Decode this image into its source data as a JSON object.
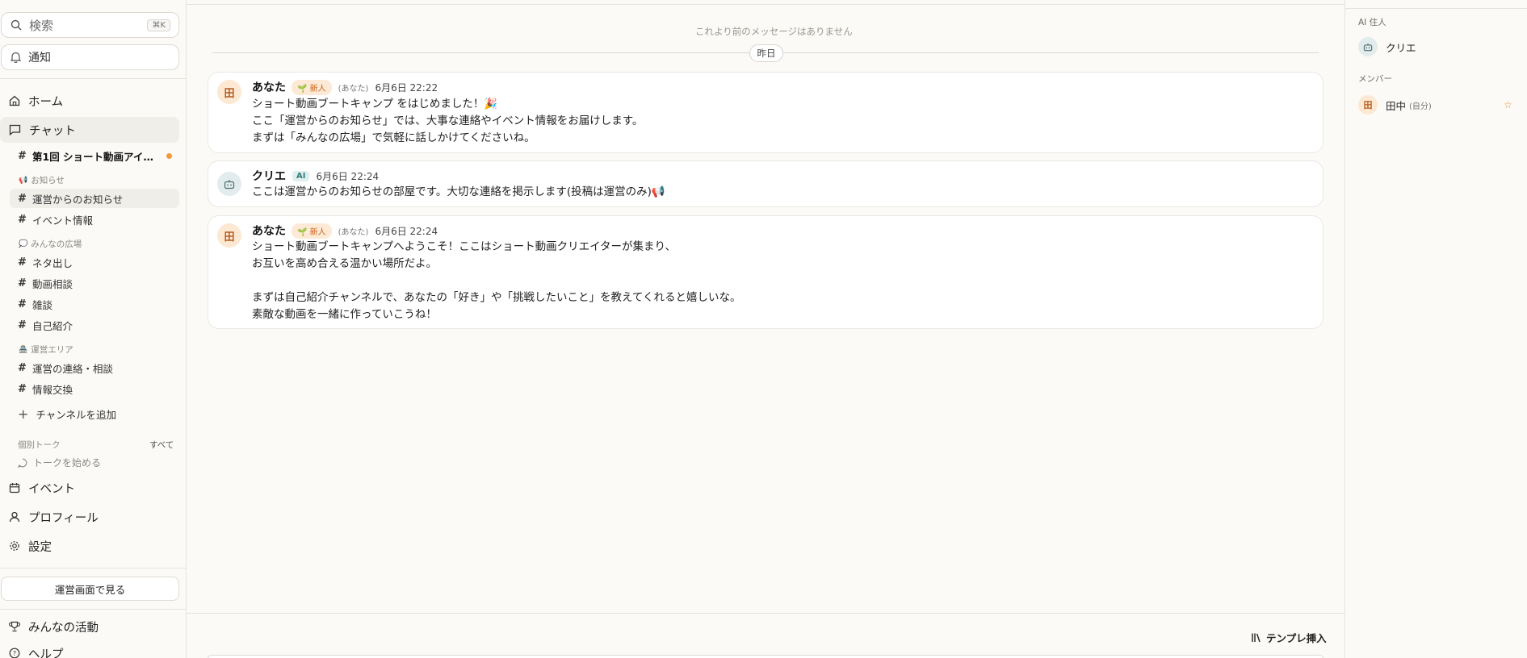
{
  "sidebar": {
    "search_placeholder": "検索",
    "search_shortcut": "⌘K",
    "notifications_label": "通知",
    "nav": {
      "home": "ホーム",
      "chat": "チャット",
      "events": "イベント",
      "profile": "プロフィール",
      "settings": "設定",
      "activity": "みんなの活動",
      "help": "ヘルプ"
    },
    "pinned_channel": "第1回 ショート動画アイデア…",
    "groups": [
      {
        "label": "お知らせ",
        "emoji": "📢",
        "channels": [
          "運営からのお知らせ",
          "イベント情報"
        ]
      },
      {
        "label": "みんなの広場",
        "emoji": "💭",
        "channels": [
          "ネタ出し",
          "動画相談",
          "雑談",
          "自己紹介"
        ]
      },
      {
        "label": "運営エリア",
        "emoji": "🏯",
        "channels": [
          "運営の連絡・相談",
          "情報交換"
        ]
      }
    ],
    "add_channel": "チャンネルを追加",
    "dm_label": "個別トーク",
    "dm_all": "すべて",
    "dm_start": "トークを始める",
    "staff_view_button": "運営画面で見る"
  },
  "main": {
    "no_previous": "これより前のメッセージはありません",
    "day_divider": "昨日",
    "messages": [
      {
        "avatar": "田",
        "name": "あなた",
        "badge": "🌱 新人",
        "you_tag": "(あなた)",
        "time": "6月6日 22:22",
        "body": "ショート動画ブートキャンプ をはじめました！🎉\nここ「運営からのお知らせ」では、大事な連絡やイベント情報をお届けします。\nまずは「みんなの広場」で気軽に話しかけてくださいね。"
      },
      {
        "avatar": "bot-icon",
        "name": "クリエ",
        "badge": "AI",
        "time": "6月6日 22:24",
        "body": "ここは運営からのお知らせの部屋です。大切な連絡を掲示します(投稿は運営のみ)📢"
      },
      {
        "avatar": "田",
        "name": "あなた",
        "badge": "🌱 新人",
        "you_tag": "(あなた)",
        "time": "6月6日 22:24",
        "body": "ショート動画ブートキャンプへようこそ！ここはショート動画クリエイターが集まり、\nお互いを高め合える温かい場所だよ。\n\nまずは自己紹介チャンネルで、あなたの「好き」や「挑戦したいこと」を教えてくれると嬉しいな。\n素敵な動画を一緒に作っていこうね！"
      }
    ],
    "template_insert": "テンプレ挿入"
  },
  "right_panel": {
    "ai_section": "AI 住人",
    "ai_member": "クリエ",
    "members_section": "メンバー",
    "member_avatar": "田",
    "member_name": "田中",
    "member_self": "(自分)"
  },
  "colors": {
    "accent_orange": "#f29a3a",
    "badge_new_bg": "#fde9d6",
    "ai_badge_bg": "#e1eeee",
    "background": "#fbfaf7"
  }
}
